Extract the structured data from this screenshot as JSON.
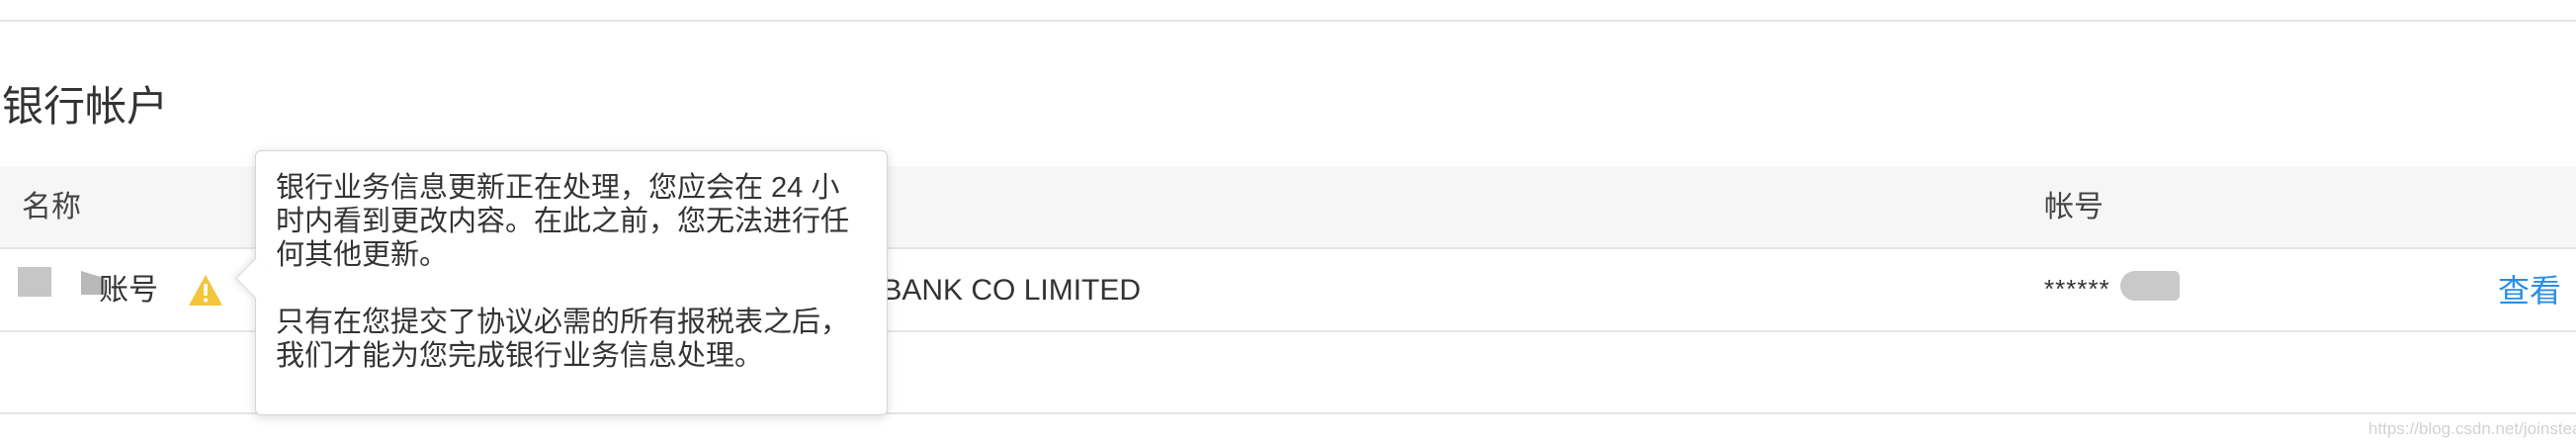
{
  "section": {
    "title": "银行帐户"
  },
  "table": {
    "headers": {
      "name": "名称",
      "account": "帐号"
    },
    "rows": [
      {
        "name": "账号",
        "bank": "S BANK CO LIMITED",
        "account": "******",
        "action": "查看"
      }
    ]
  },
  "tooltip": {
    "paragraph_1": "银行业务信息更新正在处理，您应会在 24 小时内看到更改内容。在此之前，您无法进行任何其他更新。",
    "paragraph_2": "只有在您提交了协议必需的所有报税表之后，我们才能为您完成银行业务信息处理。"
  },
  "watermark": {
    "text": "https://blog.csdn.net/joinstear"
  },
  "colors": {
    "link": "#2a8ee6",
    "warning": "#f2c53d",
    "header_bg": "#f6f6f6"
  },
  "icons": {
    "row_status": "warning-icon"
  }
}
